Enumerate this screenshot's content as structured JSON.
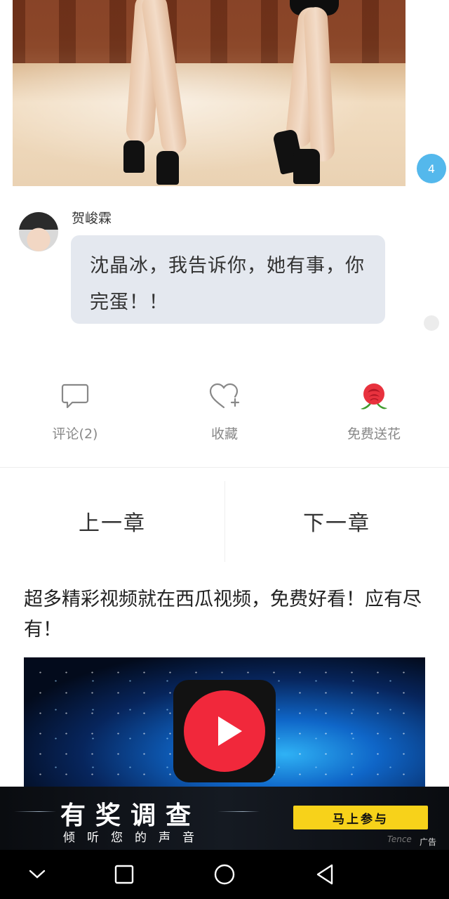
{
  "photo": {
    "alt": ""
  },
  "badge": {
    "count": "4"
  },
  "comment": {
    "author": "贺峻霖",
    "text": "沈晶冰，我告诉你，她有事，你完蛋！！"
  },
  "actions": [
    {
      "label": "评论(2)",
      "icon": "comment-bubble-icon"
    },
    {
      "label": "收藏",
      "icon": "heart-plus-icon"
    },
    {
      "label": "免费送花",
      "icon": "rose-icon"
    }
  ],
  "chapter_nav": {
    "prev": "上一章",
    "next": "下一章"
  },
  "promo": {
    "text": "超多精彩视频就在西瓜视频，免费好看！应有尽有！"
  },
  "ad": {
    "title": "有奖调查",
    "subtitle": "倾听您的声音",
    "button": "马上参与",
    "brand": "Tence",
    "tag": "广告"
  },
  "navbar": [
    "chevron-down-icon",
    "square-icon",
    "circle-icon",
    "triangle-back-icon"
  ],
  "colors": {
    "badge": "#54b8ec",
    "bubble": "#e4e8ef",
    "ad_button": "#f7d21a",
    "rose": "#e8323e"
  }
}
